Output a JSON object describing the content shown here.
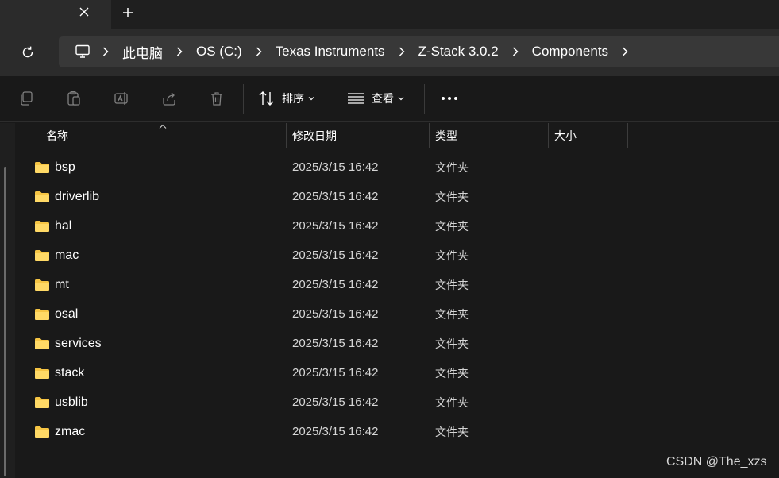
{
  "tab": {
    "close_icon": "close-icon",
    "new_tab_icon": "plus-icon"
  },
  "nav": {
    "refresh_icon": "refresh-icon",
    "breadcrumbs": [
      "此电脑",
      "OS (C:)",
      "Texas Instruments",
      "Z-Stack 3.0.2",
      "Components"
    ]
  },
  "toolbar": {
    "sort_label": "排序",
    "view_label": "查看",
    "more_icon": "more-icon"
  },
  "columns": {
    "name": "名称",
    "modified": "修改日期",
    "type": "类型",
    "size": "大小"
  },
  "files": [
    {
      "name": "bsp",
      "modified": "2025/3/15 16:42",
      "type": "文件夹",
      "size": ""
    },
    {
      "name": "driverlib",
      "modified": "2025/3/15 16:42",
      "type": "文件夹",
      "size": ""
    },
    {
      "name": "hal",
      "modified": "2025/3/15 16:42",
      "type": "文件夹",
      "size": ""
    },
    {
      "name": "mac",
      "modified": "2025/3/15 16:42",
      "type": "文件夹",
      "size": ""
    },
    {
      "name": "mt",
      "modified": "2025/3/15 16:42",
      "type": "文件夹",
      "size": ""
    },
    {
      "name": "osal",
      "modified": "2025/3/15 16:42",
      "type": "文件夹",
      "size": ""
    },
    {
      "name": "services",
      "modified": "2025/3/15 16:42",
      "type": "文件夹",
      "size": ""
    },
    {
      "name": "stack",
      "modified": "2025/3/15 16:42",
      "type": "文件夹",
      "size": ""
    },
    {
      "name": "usblib",
      "modified": "2025/3/15 16:42",
      "type": "文件夹",
      "size": ""
    },
    {
      "name": "zmac",
      "modified": "2025/3/15 16:42",
      "type": "文件夹",
      "size": ""
    }
  ],
  "watermark": "CSDN @The_xzs",
  "colors": {
    "folder": "#f6c544",
    "background": "#191919",
    "addressbar": "#383838"
  }
}
